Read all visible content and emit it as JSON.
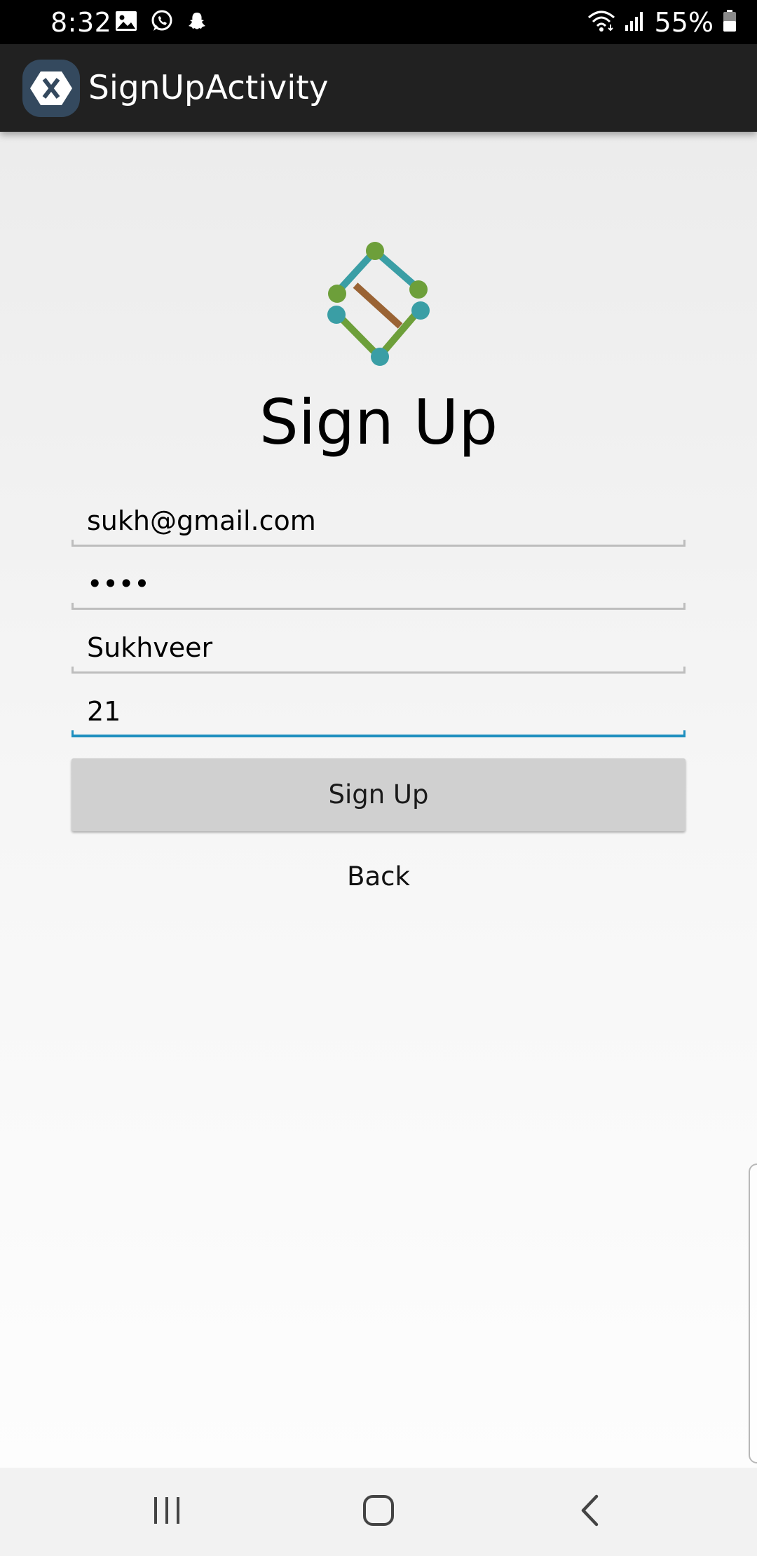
{
  "status_bar": {
    "time": "8:32",
    "icons_left": [
      "image-icon",
      "whatsapp-icon",
      "snapchat-icon"
    ],
    "icons_right": [
      "wifi-icon",
      "signal-icon"
    ],
    "battery_percent": "55%"
  },
  "action_bar": {
    "icon": "xamarin-app-icon",
    "title": "SignUpActivity"
  },
  "main": {
    "logo": "sign-up-logo",
    "heading": "Sign Up",
    "fields": {
      "email": "sukh@gmail.com",
      "password": "••••",
      "name": "Sukhveer",
      "age": "21"
    },
    "focused_field": "age",
    "sign_up_button": "Sign Up",
    "back_button": "Back"
  },
  "nav_bar": {
    "icons": [
      "recents-icon",
      "home-icon",
      "back-icon"
    ]
  },
  "colors": {
    "status_bar": "#000000",
    "action_bar": "#212121",
    "accent": "#1e8fbf",
    "button": "#d0d0d0",
    "logo_teal": "#3a9ea5",
    "logo_green": "#6d9f3a",
    "logo_brown": "#9a6334"
  }
}
